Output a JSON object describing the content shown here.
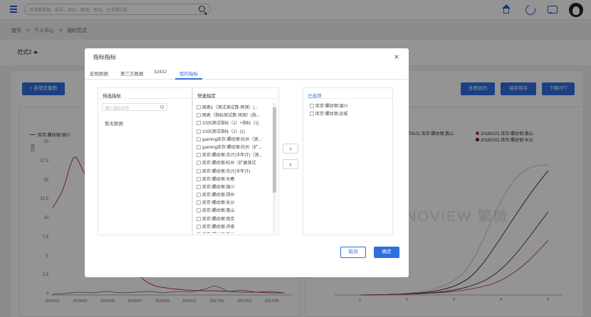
{
  "topbar": {
    "search_placeholder": "可搜索数据、报告、指标、新闻、快讯、企业等内容"
  },
  "breadcrumb": [
    "首页",
    ">",
    "个人中心",
    ">",
    "我的范式"
  ],
  "format": {
    "title": "范式2"
  },
  "toolbar": {
    "new_chart": "+ 新增定量图",
    "multi": "多图协同",
    "save_sort": "保存排序",
    "download": "下载PPT"
  },
  "left_chart": {
    "legend": "库存:螺纹钢:银川",
    "ylabel": "万吨",
    "yticks": [
      "20",
      "17.5",
      "15",
      "12.5",
      "10",
      "7.5",
      "5",
      "2.5",
      "0"
    ],
    "xticks": [
      "2016/01",
      "2016/03",
      "2016/05",
      "2016/07",
      "2016/09",
      "2016/11",
      "2017/01",
      "2017/03",
      "2017/05"
    ]
  },
  "right_chart": {
    "legend": [
      "170101 库存:螺纹钢:惠山",
      "20180101 库存:螺纹钢:惠山",
      "20180101 库存:螺纹钢:长沙"
    ],
    "xticks": [
      "1",
      "2",
      "3",
      "4",
      "5"
    ],
    "watermark": "NOVIEW 繁微",
    "colors": {
      "light": "#e8b9bd",
      "black": "#222222",
      "red": "#c8363f"
    }
  },
  "modal": {
    "title": "指标指标",
    "tabs": [
      "宏观数据",
      "第三方数据",
      "32432",
      "我的指标"
    ],
    "active_tab": 3,
    "close": "×",
    "pane_a": {
      "title": "待选指标",
      "search_placeholder": "输入指标名称",
      "empty": "暂无数据"
    },
    "pane_b": {
      "title": "快速指定",
      "items": [
        "图表1（测试测试算-预测）(...",
        "图表（指标测试算-预测）(指...",
        "1025测试指标（1）+指标（1)",
        "1025测试指标（1）(1)",
        "gaiming库存:螺纹钢:杭州（测...",
        "gaiming库存:螺纹钢:杭州（扩...",
        "库存:螺纹钢:合计(半年计)（测...",
        "库存:螺纹钢:杭州（扩展测试",
        "库存:螺纹钢:合计(半年计)",
        "库存:螺纹钢:长春",
        "库存:螺纹钢:银川",
        "库存:螺纹钢:郑州",
        "库存:螺纹钢:长沙",
        "库存:螺纹钢:惠山",
        "库存:螺纹钢:南京",
        "库存:螺纹钢:济南",
        "库存:螺纹钢:苏州",
        "库存:螺纹钢:杭州"
      ]
    },
    "pane_c": {
      "title": "已选项",
      "items": [
        "库存:螺纹钢:银川",
        "库存:螺纹钢:运城"
      ]
    },
    "move_right": "›",
    "move_left": "‹",
    "cancel": "取消",
    "confirm": "确定"
  }
}
